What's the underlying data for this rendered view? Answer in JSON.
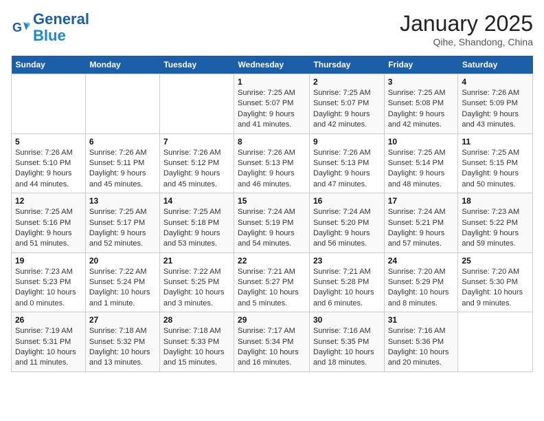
{
  "logo": {
    "line1": "General",
    "line2": "Blue"
  },
  "title": "January 2025",
  "location": "Qihe, Shandong, China",
  "weekdays": [
    "Sunday",
    "Monday",
    "Tuesday",
    "Wednesday",
    "Thursday",
    "Friday",
    "Saturday"
  ],
  "weeks": [
    [
      {
        "day": "",
        "info": ""
      },
      {
        "day": "",
        "info": ""
      },
      {
        "day": "",
        "info": ""
      },
      {
        "day": "1",
        "info": "Sunrise: 7:25 AM\nSunset: 5:07 PM\nDaylight: 9 hours and 41 minutes."
      },
      {
        "day": "2",
        "info": "Sunrise: 7:25 AM\nSunset: 5:07 PM\nDaylight: 9 hours and 42 minutes."
      },
      {
        "day": "3",
        "info": "Sunrise: 7:25 AM\nSunset: 5:08 PM\nDaylight: 9 hours and 42 minutes."
      },
      {
        "day": "4",
        "info": "Sunrise: 7:26 AM\nSunset: 5:09 PM\nDaylight: 9 hours and 43 minutes."
      }
    ],
    [
      {
        "day": "5",
        "info": "Sunrise: 7:26 AM\nSunset: 5:10 PM\nDaylight: 9 hours and 44 minutes."
      },
      {
        "day": "6",
        "info": "Sunrise: 7:26 AM\nSunset: 5:11 PM\nDaylight: 9 hours and 45 minutes."
      },
      {
        "day": "7",
        "info": "Sunrise: 7:26 AM\nSunset: 5:12 PM\nDaylight: 9 hours and 45 minutes."
      },
      {
        "day": "8",
        "info": "Sunrise: 7:26 AM\nSunset: 5:13 PM\nDaylight: 9 hours and 46 minutes."
      },
      {
        "day": "9",
        "info": "Sunrise: 7:26 AM\nSunset: 5:13 PM\nDaylight: 9 hours and 47 minutes."
      },
      {
        "day": "10",
        "info": "Sunrise: 7:25 AM\nSunset: 5:14 PM\nDaylight: 9 hours and 48 minutes."
      },
      {
        "day": "11",
        "info": "Sunrise: 7:25 AM\nSunset: 5:15 PM\nDaylight: 9 hours and 50 minutes."
      }
    ],
    [
      {
        "day": "12",
        "info": "Sunrise: 7:25 AM\nSunset: 5:16 PM\nDaylight: 9 hours and 51 minutes."
      },
      {
        "day": "13",
        "info": "Sunrise: 7:25 AM\nSunset: 5:17 PM\nDaylight: 9 hours and 52 minutes."
      },
      {
        "day": "14",
        "info": "Sunrise: 7:25 AM\nSunset: 5:18 PM\nDaylight: 9 hours and 53 minutes."
      },
      {
        "day": "15",
        "info": "Sunrise: 7:24 AM\nSunset: 5:19 PM\nDaylight: 9 hours and 54 minutes."
      },
      {
        "day": "16",
        "info": "Sunrise: 7:24 AM\nSunset: 5:20 PM\nDaylight: 9 hours and 56 minutes."
      },
      {
        "day": "17",
        "info": "Sunrise: 7:24 AM\nSunset: 5:21 PM\nDaylight: 9 hours and 57 minutes."
      },
      {
        "day": "18",
        "info": "Sunrise: 7:23 AM\nSunset: 5:22 PM\nDaylight: 9 hours and 59 minutes."
      }
    ],
    [
      {
        "day": "19",
        "info": "Sunrise: 7:23 AM\nSunset: 5:23 PM\nDaylight: 10 hours and 0 minutes."
      },
      {
        "day": "20",
        "info": "Sunrise: 7:22 AM\nSunset: 5:24 PM\nDaylight: 10 hours and 1 minute."
      },
      {
        "day": "21",
        "info": "Sunrise: 7:22 AM\nSunset: 5:25 PM\nDaylight: 10 hours and 3 minutes."
      },
      {
        "day": "22",
        "info": "Sunrise: 7:21 AM\nSunset: 5:27 PM\nDaylight: 10 hours and 5 minutes."
      },
      {
        "day": "23",
        "info": "Sunrise: 7:21 AM\nSunset: 5:28 PM\nDaylight: 10 hours and 6 minutes."
      },
      {
        "day": "24",
        "info": "Sunrise: 7:20 AM\nSunset: 5:29 PM\nDaylight: 10 hours and 8 minutes."
      },
      {
        "day": "25",
        "info": "Sunrise: 7:20 AM\nSunset: 5:30 PM\nDaylight: 10 hours and 9 minutes."
      }
    ],
    [
      {
        "day": "26",
        "info": "Sunrise: 7:19 AM\nSunset: 5:31 PM\nDaylight: 10 hours and 11 minutes."
      },
      {
        "day": "27",
        "info": "Sunrise: 7:18 AM\nSunset: 5:32 PM\nDaylight: 10 hours and 13 minutes."
      },
      {
        "day": "28",
        "info": "Sunrise: 7:18 AM\nSunset: 5:33 PM\nDaylight: 10 hours and 15 minutes."
      },
      {
        "day": "29",
        "info": "Sunrise: 7:17 AM\nSunset: 5:34 PM\nDaylight: 10 hours and 16 minutes."
      },
      {
        "day": "30",
        "info": "Sunrise: 7:16 AM\nSunset: 5:35 PM\nDaylight: 10 hours and 18 minutes."
      },
      {
        "day": "31",
        "info": "Sunrise: 7:16 AM\nSunset: 5:36 PM\nDaylight: 10 hours and 20 minutes."
      },
      {
        "day": "",
        "info": ""
      }
    ]
  ]
}
